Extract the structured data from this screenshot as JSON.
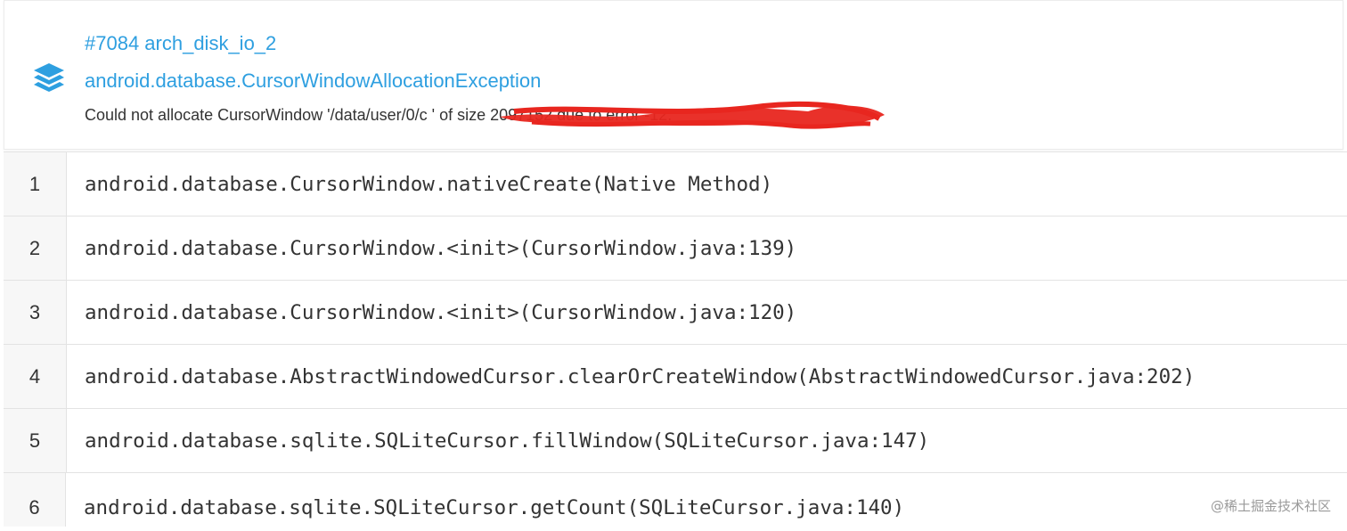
{
  "issue": {
    "id_title": "#7084 arch_disk_io_2",
    "exception": "android.database.CursorWindowAllocationException",
    "message": "Could not allocate CursorWindow '/data/user/0/c                                                                                    ' of size 2097152 due to error -12.",
    "icon": "layers-icon",
    "accent_color": "#2e9fe0",
    "redaction_color": "#e8261f"
  },
  "stack": [
    {
      "line": "1",
      "frame": "android.database.CursorWindow.nativeCreate(Native Method)"
    },
    {
      "line": "2",
      "frame": "android.database.CursorWindow.<init>(CursorWindow.java:139)"
    },
    {
      "line": "3",
      "frame": "android.database.CursorWindow.<init>(CursorWindow.java:120)"
    },
    {
      "line": "4",
      "frame": "android.database.AbstractWindowedCursor.clearOrCreateWindow(AbstractWindowedCursor.java:202)"
    },
    {
      "line": "5",
      "frame": "android.database.sqlite.SQLiteCursor.fillWindow(SQLiteCursor.java:147)"
    },
    {
      "line": "6",
      "frame": "android.database.sqlite.SQLiteCursor.getCount(SQLiteCursor.java:140)"
    }
  ],
  "watermark": "@稀土掘金技术社区"
}
